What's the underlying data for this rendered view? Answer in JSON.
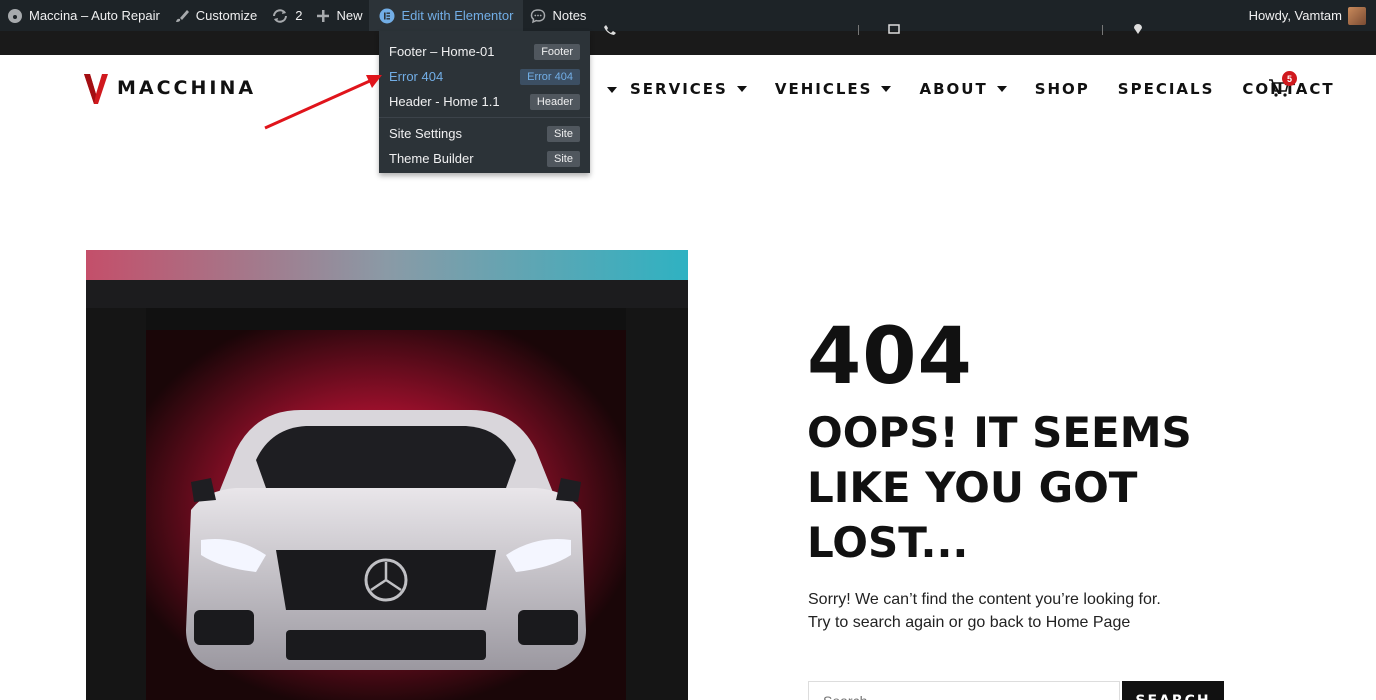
{
  "adminbar": {
    "site_name": "Maccina – Auto Repair",
    "customize": "Customize",
    "updates_count": "2",
    "new_label": "New",
    "edit_elementor": "Edit with Elementor",
    "notes": "Notes",
    "howdy": "Howdy, Vamtam"
  },
  "dropdown": {
    "items": [
      {
        "label": "Footer – Home-01",
        "tag": "Footer"
      },
      {
        "label": "Error 404",
        "tag": "Error 404"
      },
      {
        "label": "Header - Home 1.1",
        "tag": "Header"
      },
      {
        "label": "Site Settings",
        "tag": "Site"
      },
      {
        "label": "Theme Builder",
        "tag": "Site"
      }
    ]
  },
  "header": {
    "brand": "MACCHINA",
    "nav": [
      "SERVICES",
      "VEHICLES",
      "ABOUT",
      "SHOP",
      "SPECIALS",
      "CONTACT"
    ],
    "cart_count": "5"
  },
  "error": {
    "code": "404",
    "title": "OOPS! IT SEEMS LIKE YOU GOT LOST...",
    "text_line1": "Sorry! We can’t find the content you’re looking for.",
    "text_line2": "Try to search again or go back to Home Page",
    "search_placeholder": "Search...",
    "search_button": "SEARCH"
  },
  "colors": {
    "adminbar_bg": "#1d2327",
    "accent_blue": "#72aee6",
    "brand_red": "#d0191e",
    "text_dark": "#111111"
  }
}
